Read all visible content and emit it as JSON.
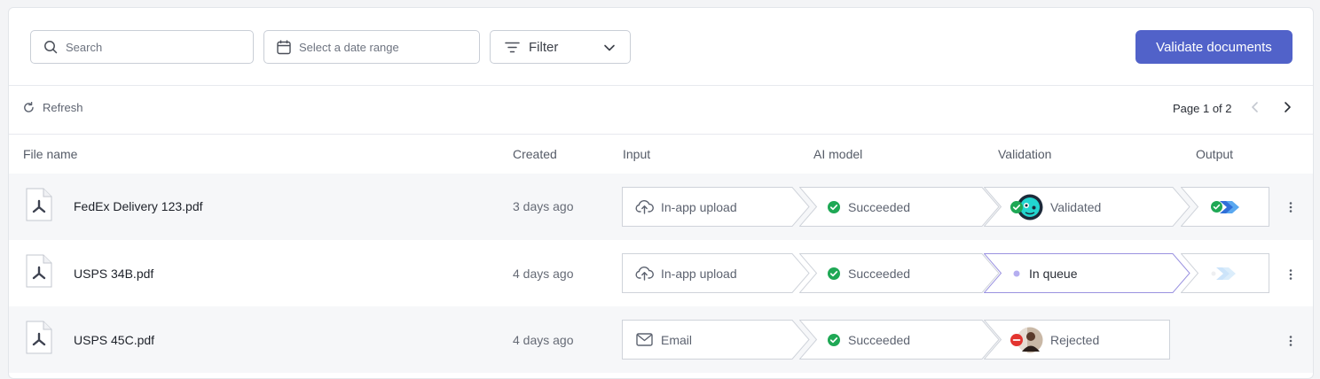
{
  "toolbar": {
    "search_placeholder": "Search",
    "date_placeholder": "Select a date range",
    "filter_label": "Filter",
    "validate_label": "Validate documents"
  },
  "subbar": {
    "refresh_label": "Refresh",
    "page_info": "Page 1 of 2"
  },
  "columns": {
    "file_name": "File name",
    "created": "Created",
    "input": "Input",
    "ai_model": "AI model",
    "validation": "Validation",
    "output": "Output"
  },
  "rows": [
    {
      "file_name": "FedEx Delivery 123.pdf",
      "created": "3 days ago",
      "input": "In-app upload",
      "ai_model": "Succeeded",
      "validation": "Validated"
    },
    {
      "file_name": "USPS 34B.pdf",
      "created": "4 days ago",
      "input": "In-app upload",
      "ai_model": "Succeeded",
      "validation": "In queue"
    },
    {
      "file_name": "USPS 45C.pdf",
      "created": "4 days ago",
      "input": "Email",
      "ai_model": "Succeeded",
      "validation": "Rejected"
    }
  ],
  "colors": {
    "primary": "#5162c9",
    "success": "#1fa855",
    "danger": "#e3342f",
    "queue": "#8a80e0",
    "border": "#c9ced6"
  },
  "icons": [
    "search-icon",
    "calendar-icon",
    "filter-icon",
    "chevron-down-icon",
    "refresh-icon",
    "chevron-left-icon",
    "chevron-right-icon",
    "pdf-file-icon",
    "upload-icon",
    "email-icon",
    "check-circle-icon",
    "reject-icon",
    "output-integration-icon",
    "more-vertical-icon"
  ]
}
